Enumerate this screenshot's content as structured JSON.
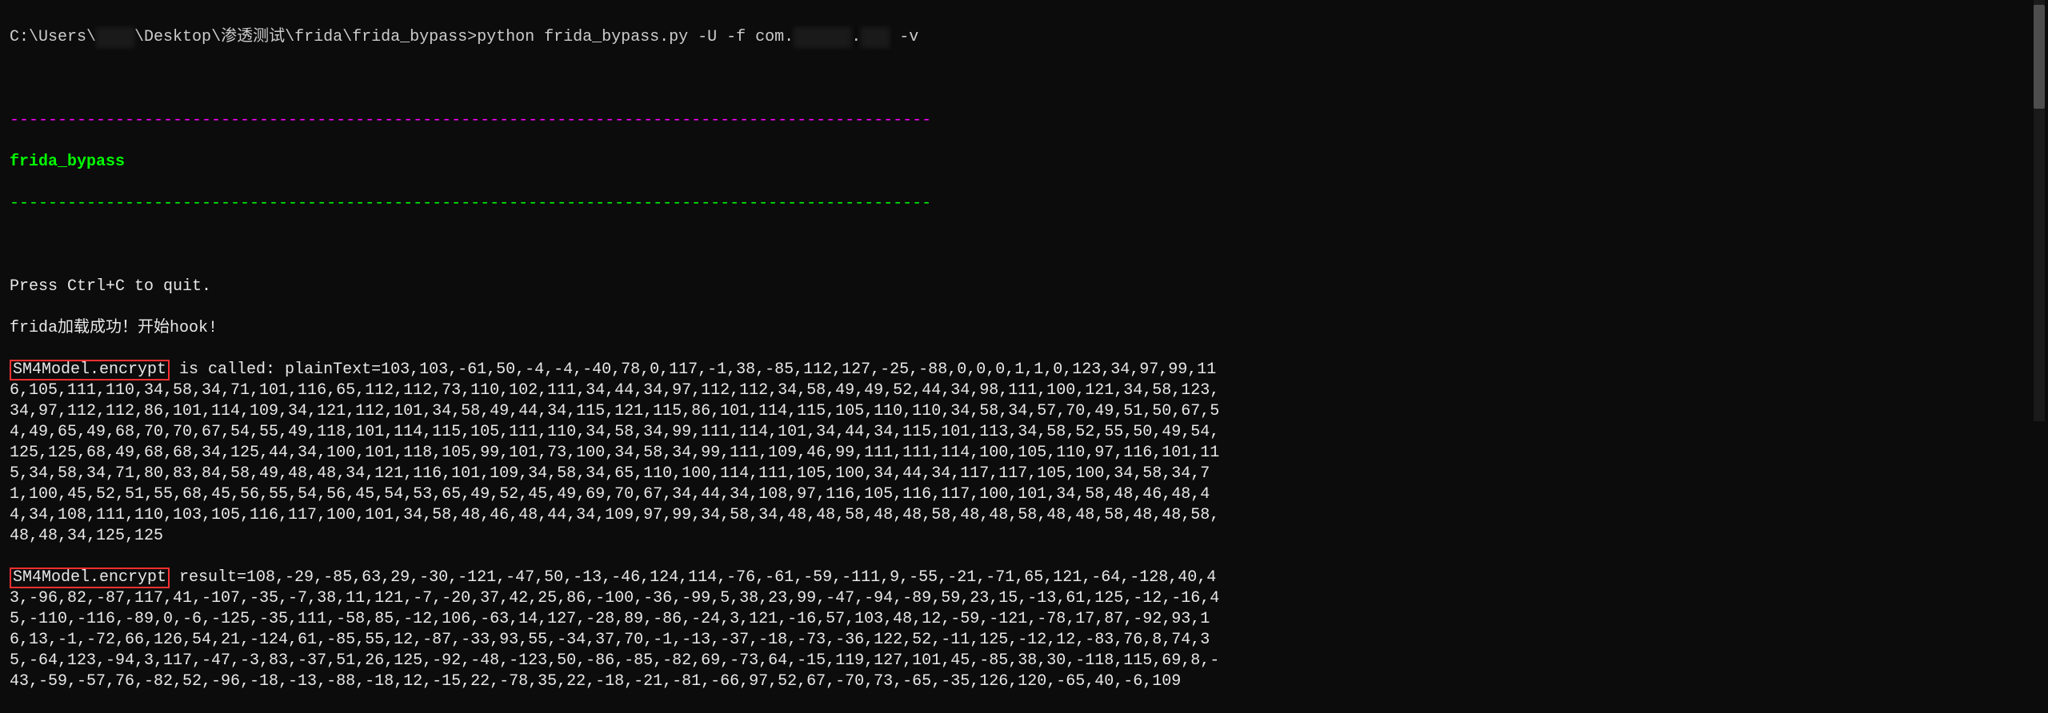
{
  "prompt": {
    "prefix": "C:\\Users\\",
    "redacted_user": "████",
    "mid": "\\Desktop\\渗透测试\\frida\\frida_bypass>",
    "cmd_prefix": "python frida_bypass.py -U -f com.",
    "redacted_pkg1": "██████",
    "redacted_pkg2": "███",
    "cmd_suffix": " -v"
  },
  "sep_magenta": "------------------------------------------------------------------------------------------------",
  "title": "frida_bypass",
  "sep_green": "------------------------------------------------------------------------------------------------",
  "press_quit": "Press Ctrl+C to quit.",
  "frida_loaded": "frida加载成功！开始hook!",
  "call1": {
    "label": "SM4Model.encrypt",
    "tail": " is called: plainText=103,103,-61,50,-4,-4,-40,78,0,117,-1,38,-85,112,127,-25,-88,0,0,0,1,1,0,123,34,97,99,116,105,111,110,34,58,34,71,101,116,65,112,112,73,110,102,111,34,44,34,97,112,112,34,58,49,49,52,44,34,98,111,100,121,34,58,123,34,97,112,112,86,101,114,109,34,121,112,101,34,58,49,44,34,115,121,115,86,101,114,115,105,110,110,34,58,34,57,70,49,51,50,67,54,49,65,49,68,70,70,67,54,55,49,118,101,114,115,105,111,110,34,58,34,99,111,114,101,34,44,34,115,101,113,34,58,52,55,50,49,54,125,125,68,49,68,68,34,125,44,34,100,101,118,105,99,101,73,100,34,58,34,99,111,109,46,99,111,111,114,100,105,110,97,116,101,115,34,58,34,71,80,83,84,58,49,48,48,34,121,116,101,109,34,58,34,65,110,100,114,111,105,100,34,44,34,117,117,105,100,34,58,34,71,100,45,52,51,55,68,45,56,55,54,56,45,54,53,65,49,52,45,49,69,70,67,34,44,34,108,97,116,105,116,117,100,101,34,58,48,46,48,44,34,108,111,110,103,105,116,117,100,101,34,58,48,46,48,44,34,109,97,99,34,58,34,48,48,58,48,48,58,48,48,58,48,48,58,48,48,58,48,48,34,125,125"
  },
  "call2": {
    "label": "SM4Model.encrypt",
    "tail": " result=108,-29,-85,63,29,-30,-121,-47,50,-13,-46,124,114,-76,-61,-59,-111,9,-55,-21,-71,65,121,-64,-128,40,43,-96,82,-87,117,41,-107,-35,-7,38,11,121,-7,-20,37,42,25,86,-100,-36,-99,5,38,23,99,-47,-94,-89,59,23,15,-13,61,125,-12,-16,45,-110,-116,-89,0,-6,-125,-35,111,-58,85,-12,106,-63,14,127,-28,89,-86,-24,3,121,-16,57,103,48,12,-59,-121,-78,17,87,-92,93,16,13,-1,-72,66,126,54,21,-124,61,-85,55,12,-87,-33,93,55,-34,37,70,-1,-13,-37,-18,-73,-36,122,52,-11,125,-12,12,-83,76,8,74,35,-64,123,-94,3,117,-47,-3,83,-37,51,26,125,-92,-48,-123,50,-86,-85,-82,69,-73,64,-15,119,127,101,45,-85,38,30,-118,115,69,8,-43,-59,-57,76,-82,52,-96,-18,-13,-88,-18,12,-15,22,-78,35,22,-18,-21,-81,-66,97,52,67,-70,73,-65,-35,126,120,-65,40,-6,109"
  }
}
